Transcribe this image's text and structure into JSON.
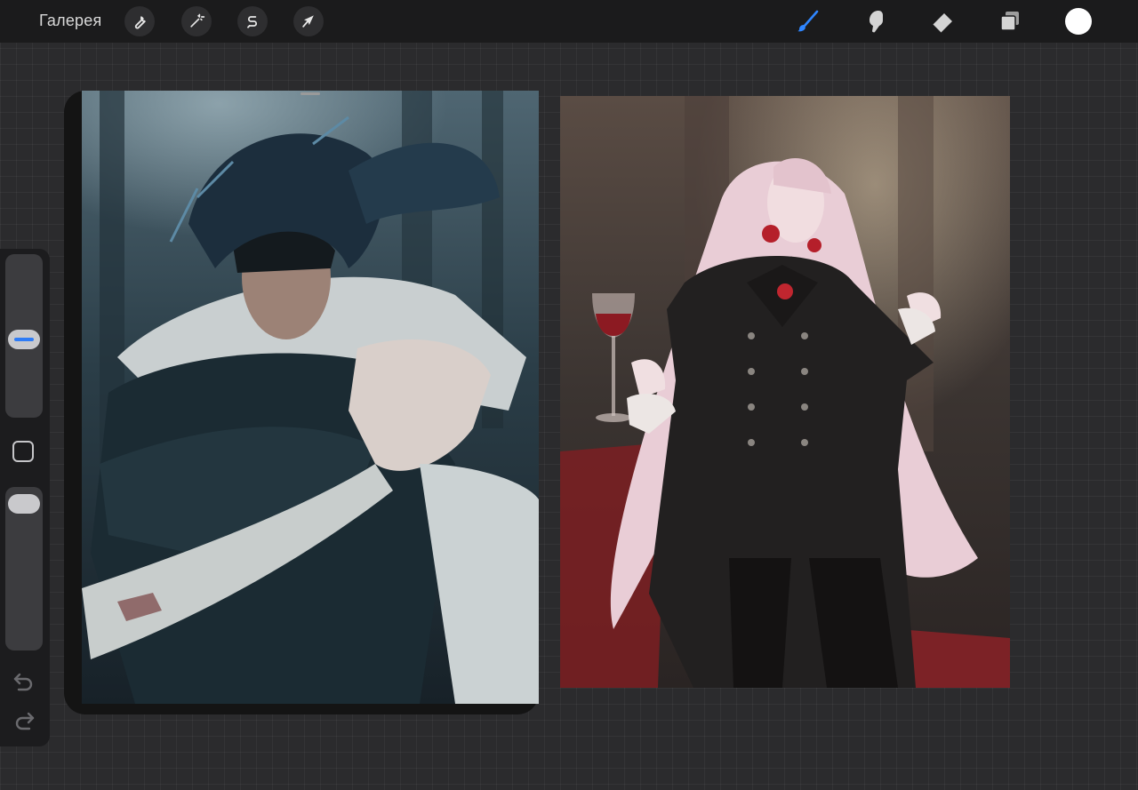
{
  "toolbar": {
    "gallery_label": "Галерея",
    "actions": [
      {
        "name": "wrench-icon"
      },
      {
        "name": "magic-wand-icon"
      },
      {
        "name": "selection-icon"
      },
      {
        "name": "transform-arrow-icon"
      }
    ],
    "tools": [
      {
        "name": "brush-icon",
        "active": true,
        "color": "#2f86ff"
      },
      {
        "name": "smudge-icon",
        "active": false,
        "color": "#d4d4d4"
      },
      {
        "name": "eraser-icon",
        "active": false,
        "color": "#d4d4d4"
      },
      {
        "name": "layers-icon",
        "active": false,
        "color": "#d4d4d4"
      }
    ],
    "current_color": "#ffffff"
  },
  "sidebar": {
    "brush_size_level": 0.35,
    "opacity_level": 0.05,
    "undo_icon": "undo-icon",
    "redo_icon": "redo-icon"
  },
  "canvas": {
    "artworks": [
      {
        "name": "artwork-dark-haired-warrior",
        "palette": [
          "#1e2b33",
          "#3a5566",
          "#cfd6d8"
        ]
      },
      {
        "name": "artwork-pale-haired-vampire",
        "palette": [
          "#3a3230",
          "#e9c8d2",
          "#b3242c"
        ]
      }
    ]
  }
}
